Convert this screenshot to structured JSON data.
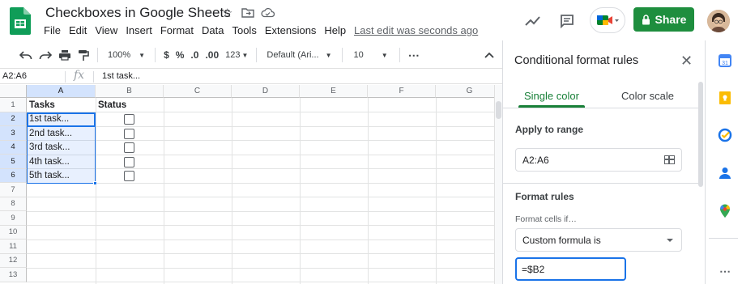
{
  "document": {
    "title": "Checkboxes in Google Sheets",
    "last_edit": "Last edit was seconds ago"
  },
  "menu": [
    "File",
    "Edit",
    "View",
    "Insert",
    "Format",
    "Data",
    "Tools",
    "Extensions",
    "Help"
  ],
  "header": {
    "share_label": "Share"
  },
  "toolbar": {
    "zoom": "100%",
    "currency": "$",
    "percent": "%",
    "dec_decrease": ".0",
    "dec_increase": ".00",
    "number_format": "123",
    "font": "Default (Ari...",
    "font_size": "10",
    "more": "⋯"
  },
  "formula_bar": {
    "name_box": "A2:A6",
    "fx": "fx",
    "content": "1st task..."
  },
  "grid": {
    "columns": [
      "A",
      "B",
      "C",
      "D",
      "E",
      "F",
      "G"
    ],
    "rows": [
      "1",
      "2",
      "3",
      "4",
      "5",
      "6",
      "7",
      "8",
      "9",
      "10",
      "11",
      "12",
      "13"
    ],
    "header_row": [
      "Tasks",
      "Status"
    ],
    "tasks": [
      "1st task...",
      "2nd task...",
      "3rd task...",
      "4th task...",
      "5th task..."
    ]
  },
  "panel": {
    "title": "Conditional format rules",
    "tab_single": "Single color",
    "tab_scale": "Color scale",
    "apply_label": "Apply to range",
    "range": "A2:A6",
    "rules_label": "Format rules",
    "cells_if": "Format cells if…",
    "condition": "Custom formula is",
    "formula": "=$B2"
  },
  "colors": {
    "share_green": "#1e8e3e",
    "accent_blue": "#1a73e8",
    "tab_green": "#188038"
  }
}
